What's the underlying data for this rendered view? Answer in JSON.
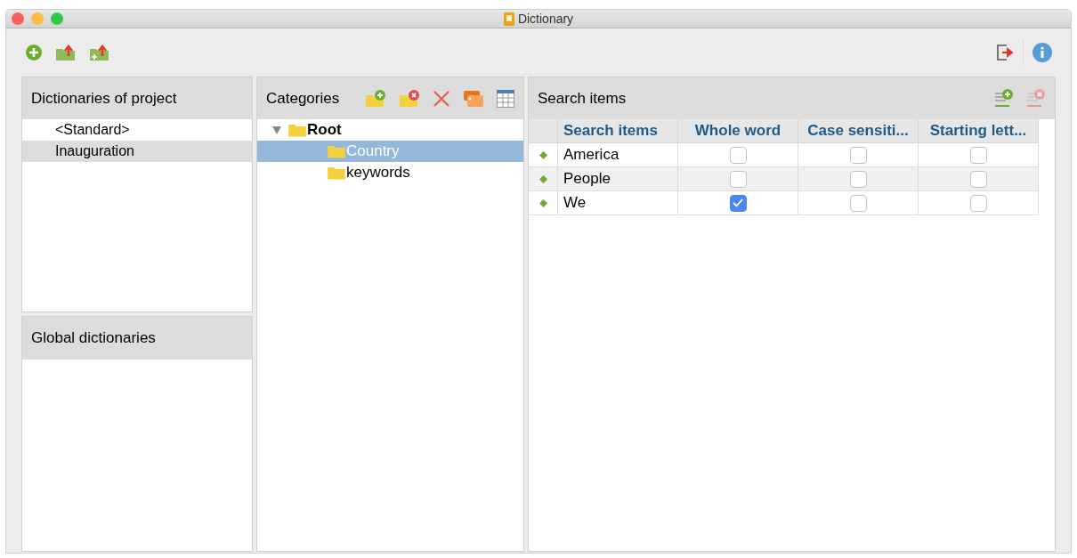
{
  "window": {
    "title": "Dictionary"
  },
  "dictionaries_of_project": {
    "header": "Dictionaries of project",
    "items": [
      {
        "label": "<Standard>",
        "selected": false
      },
      {
        "label": "Inauguration",
        "selected": true
      }
    ]
  },
  "global_dictionaries": {
    "header": "Global dictionaries"
  },
  "categories": {
    "header": "Categories",
    "tree": [
      {
        "label": "Root",
        "expanded": true,
        "selected": false,
        "children": [
          {
            "label": "Country",
            "selected": true
          },
          {
            "label": "keywords",
            "selected": false
          }
        ]
      }
    ]
  },
  "search_items": {
    "header": "Search items",
    "columns": [
      "Search items",
      "Whole word",
      "Case sensiti...",
      "Starting lett..."
    ],
    "rows": [
      {
        "term": "America",
        "checks": [
          false,
          false,
          false
        ]
      },
      {
        "term": "People",
        "checks": [
          false,
          false,
          false
        ]
      },
      {
        "term": "We",
        "checks": [
          true,
          false,
          false
        ]
      }
    ]
  }
}
